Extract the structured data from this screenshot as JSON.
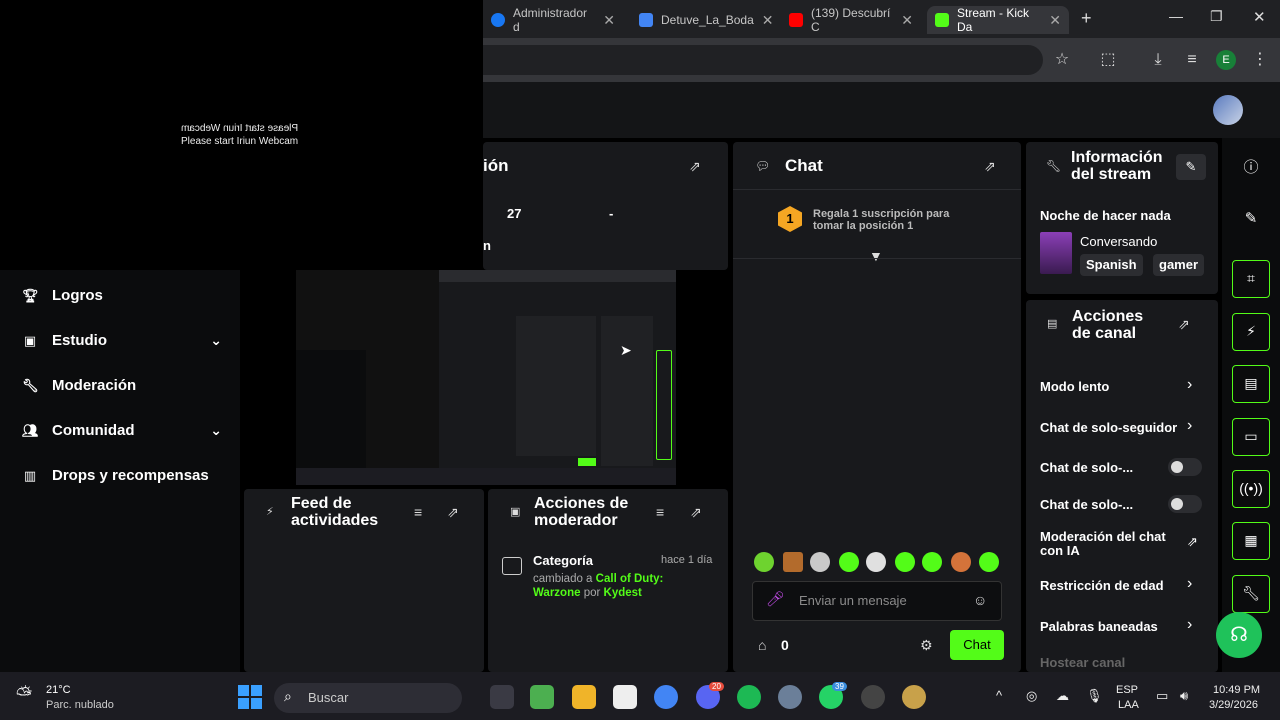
{
  "browser": {
    "tabs": [
      {
        "title": "Administrador d",
        "color": "#1877f2"
      },
      {
        "title": "Detuve_La_Boda",
        "color": "#4285f4"
      },
      {
        "title": "(139) Descubrí C",
        "color": "#ff0000"
      },
      {
        "title": "Stream - Kick Da",
        "color": "#53fc18"
      }
    ],
    "new_tab": "+",
    "profile_initial": "E"
  },
  "webcam": {
    "mirrored_text": "Please start Iriun Webcam",
    "text": "Please start Iriun Webcam"
  },
  "sidebar": {
    "items": [
      {
        "label": "Logros",
        "icon": "trophy-icon",
        "has_chevron": false
      },
      {
        "label": "Estudio",
        "icon": "studio-icon",
        "has_chevron": true
      },
      {
        "label": "Moderación",
        "icon": "wrench-icon",
        "has_chevron": false
      },
      {
        "label": "Comunidad",
        "icon": "community-icon",
        "has_chevron": true
      },
      {
        "label": "Drops y recompensas",
        "icon": "drops-icon",
        "has_chevron": false
      }
    ]
  },
  "partial_panel": {
    "title_fragment": "ión",
    "value": "27",
    "dash": "-",
    "row2_fragment": "n"
  },
  "activity_feed": {
    "title_line1": "Feed de",
    "title_line2": "actividades"
  },
  "mod_actions": {
    "title_line1": "Acciones de",
    "title_line2": "moderador",
    "entry": {
      "title": "Categoría",
      "time": "hace 1 día",
      "prefix": "cambiado a",
      "game": "Call of Duty: Warzone",
      "by": "por",
      "user": "Kydest"
    }
  },
  "chat": {
    "title": "Chat",
    "gift_badge": "1",
    "gift_text": "Regala 1 suscripción para tomar la posición 1",
    "input_placeholder": "Enviar un mensaje",
    "points": "0",
    "send_label": "Chat"
  },
  "stream_info": {
    "title_line1": "Información",
    "title_line2": "del stream",
    "stream_title": "Noche de hacer nada",
    "category": "Conversando",
    "tags": [
      "Spanish",
      "gamer"
    ]
  },
  "channel_actions": {
    "title_line1": "Acciones",
    "title_line2": "de canal",
    "items": [
      {
        "label": "Modo lento",
        "control": "chevron"
      },
      {
        "label": "Chat de solo-seguidor",
        "control": "chevron"
      },
      {
        "label": "Chat de solo-...",
        "control": "toggle"
      },
      {
        "label": "Chat de solo-...",
        "control": "toggle"
      },
      {
        "label_line1": "Moderación del chat",
        "label_line2": "con IA",
        "control": "external"
      },
      {
        "label": "Restricción de edad",
        "control": "chevron"
      },
      {
        "label": "Palabras baneadas",
        "control": "chevron"
      },
      {
        "label": "Hostear canal",
        "control": "none"
      }
    ]
  },
  "taskbar": {
    "weather_temp": "21°C",
    "weather_desc": "Parc. nublado",
    "search_placeholder": "Buscar",
    "discord_badge": "20",
    "whatsapp_badge": "39",
    "lang_line1": "ESP",
    "lang_line2": "LAA",
    "time": "10:49 PM",
    "date": "3/29/2026"
  }
}
